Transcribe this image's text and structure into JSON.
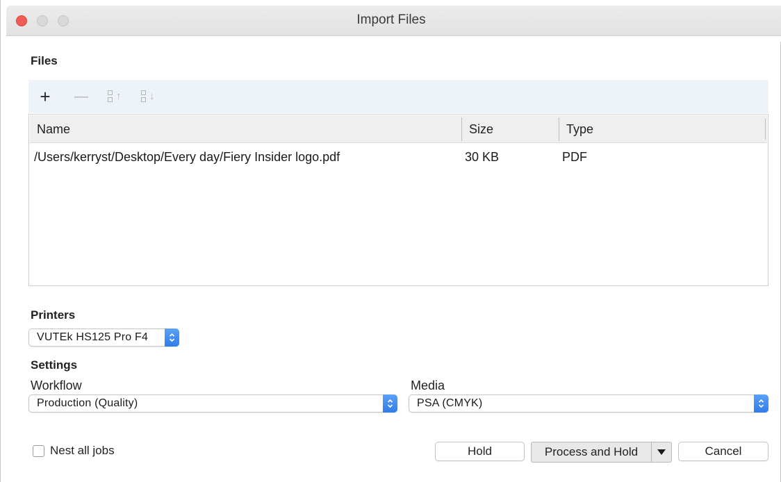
{
  "window": {
    "title": "Import Files"
  },
  "files": {
    "section_label": "Files",
    "toolbar": {
      "add_icon": "plus-icon",
      "remove_icon": "minus-icon",
      "move_up_icon": "move-up-icon",
      "move_down_icon": "move-down-icon",
      "add_glyph": "+",
      "remove_glyph": "—"
    },
    "columns": [
      "Name",
      "Size",
      "Type"
    ],
    "rows": [
      {
        "name": "/Users/kerryst/Desktop/Every day/Fiery Insider logo.pdf",
        "size": "30 KB",
        "type": "PDF"
      }
    ]
  },
  "printers": {
    "section_label": "Printers",
    "selected": "VUTEk HS125 Pro F4"
  },
  "settings": {
    "section_label": "Settings",
    "workflow": {
      "label": "Workflow",
      "selected": "Production (Quality)"
    },
    "media": {
      "label": "Media",
      "selected": "PSA (CMYK)"
    }
  },
  "footer": {
    "nest_label": "Nest all jobs",
    "nest_checked": false,
    "hold_label": "Hold",
    "process_hold_label": "Process and Hold",
    "cancel_label": "Cancel"
  },
  "colors": {
    "accent": "#2f7de8",
    "close": "#ee5c55",
    "toolbar_bg": "#eef3fa"
  }
}
